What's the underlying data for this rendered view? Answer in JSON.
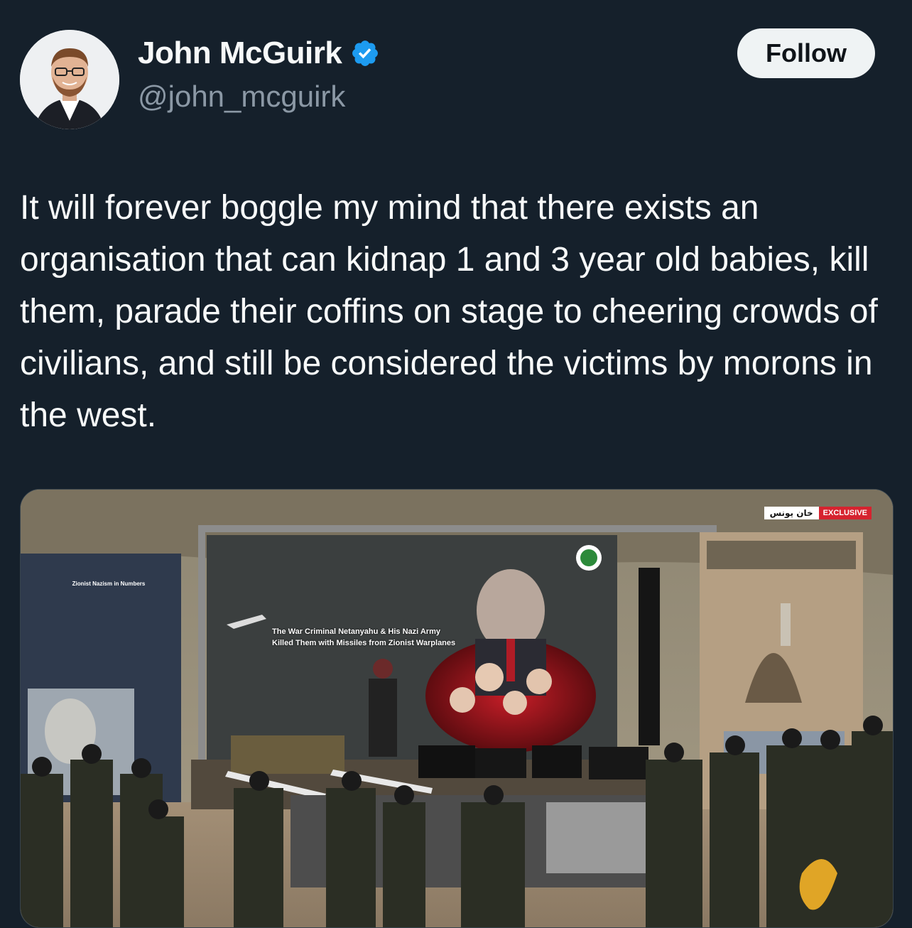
{
  "author": {
    "display_name": "John McGuirk",
    "handle": "@john_mcguirk",
    "verified": true,
    "verified_color": "#1d9bf0"
  },
  "actions": {
    "follow_label": "Follow"
  },
  "tweet": {
    "text": "It will forever boggle my mind that there exists an organisation that can kidnap 1 and 3 year old babies, kill them, parade their coffins on stage to cheering crowds of civilians, and still be considered the victims by morons in the west."
  },
  "media": {
    "location_tag": "خان يونس",
    "exclusive_tag": "EXCLUSIVE",
    "banner_english": "The War Criminal Netanyahu & His Nazi Army Killed Them with Missiles from Zionist Warplanes",
    "left_panel_title": "Zionist Nazism in Numbers"
  },
  "colors": {
    "background": "#15202b",
    "text_primary": "#f7f9f9",
    "text_secondary": "#8b98a5",
    "follow_bg": "#eff3f4",
    "follow_text": "#0f1419",
    "exclusive_bg": "#d6232f"
  }
}
